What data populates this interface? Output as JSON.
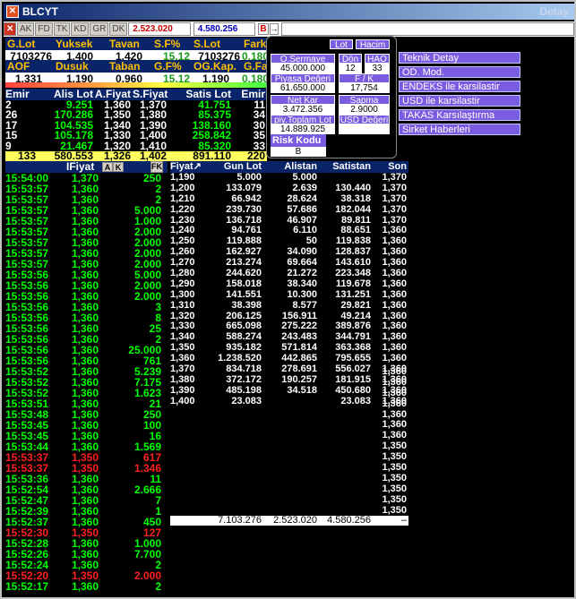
{
  "window": {
    "title": "BLCYT",
    "right_label": "Detay"
  },
  "toolbar": {
    "buttons": [
      "AK",
      "FD",
      "TK",
      "KD",
      "GR",
      "DK"
    ],
    "value1": "2.523.020",
    "value2": "4.580.256",
    "b_label": "B",
    "arrow": "→"
  },
  "quote_row1": {
    "headers": [
      "G.Lot",
      "Yuksek",
      "Tavan",
      "S.F%",
      "S.Lot",
      "Fark"
    ],
    "values": [
      "7103276",
      "1,400",
      "1,420",
      "15,12",
      "7103276",
      "0,180"
    ]
  },
  "quote_row2": {
    "headers": [
      "AOF",
      "Dusuk",
      "Taban",
      "G.F%",
      "OG.Kap.",
      "G.Fark"
    ],
    "values": [
      "1,331",
      "1,190",
      "0,960",
      "15,12",
      "1,190",
      "0,180"
    ]
  },
  "depth": {
    "headers": [
      "Emir",
      "Alis Lot",
      "A.Fiyat",
      "S.Fiyat",
      "Satis Lot",
      "Emir"
    ],
    "rows": [
      [
        "2",
        "9.251",
        "1,360",
        "1,370",
        "41.751",
        "11"
      ],
      [
        "26",
        "170.286",
        "1,350",
        "1,380",
        "85.375",
        "34"
      ],
      [
        "17",
        "104.535",
        "1,340",
        "1,390",
        "138.160",
        "30"
      ],
      [
        "15",
        "105.178",
        "1,330",
        "1,400",
        "258.842",
        "35"
      ],
      [
        "9",
        "21.467",
        "1,320",
        "1,410",
        "85.320",
        "33"
      ]
    ],
    "totals": [
      "133",
      "580.553",
      "1,326",
      "1,402",
      "891.110",
      "220"
    ]
  },
  "info": {
    "lot": "Lot",
    "hacim": "Hacim",
    "osermaye_label": "O.Sermaye",
    "osermaye": "45.000.000",
    "don_label": "Dön",
    "don": "12",
    "hao_label": "HAO",
    "hao": "33",
    "piyasa_label": "Piyasa Değeri",
    "piyasa": "61.650.000",
    "fk_label": "F / K",
    "fk": "17,754",
    "netkar_label": "Net Kar",
    "netkar": "3.472.356",
    "sapma_label": "Sapma",
    "sapma": "2.9000",
    "ptoplam_label": "piy.Toplam Lot",
    "ptoplam": "14.889.925",
    "usd_label": "USD Değeri",
    "usd": "",
    "risk_label": "Risk Kodu",
    "risk": "B"
  },
  "menu": [
    "Teknik Detay",
    "OD. Mod.",
    "ENDEKS ile karsilastir",
    "USD ile karsilastir",
    "TAKAS Karsılaştırma",
    "Sirket Haberleri"
  ],
  "trades": {
    "headers": {
      "time": "",
      "price": "IFiyat",
      "a": "A",
      "k": "K",
      "lot": "",
      "fk": "FK"
    },
    "rows": [
      [
        "15:54:00",
        "1,370",
        "250",
        ""
      ],
      [
        "15:53:57",
        "1,360",
        "2",
        ""
      ],
      [
        "15:53:57",
        "1,360",
        "2",
        ""
      ],
      [
        "15:53:57",
        "1,360",
        "5.000",
        ""
      ],
      [
        "15:53:57",
        "1,360",
        "1.000",
        ""
      ],
      [
        "15:53:57",
        "1,360",
        "2.000",
        ""
      ],
      [
        "15:53:57",
        "1,360",
        "2.000",
        ""
      ],
      [
        "15:53:57",
        "1,360",
        "2.000",
        ""
      ],
      [
        "15:53:57",
        "1,360",
        "2.000",
        ""
      ],
      [
        "15:53:56",
        "1,360",
        "5.000",
        ""
      ],
      [
        "15:53:56",
        "1,360",
        "2.000",
        ""
      ],
      [
        "15:53:56",
        "1,360",
        "2.000",
        ""
      ],
      [
        "15:53:56",
        "1,360",
        "3",
        ""
      ],
      [
        "15:53:56",
        "1,360",
        "8",
        ""
      ],
      [
        "15:53:56",
        "1,360",
        "25",
        ""
      ],
      [
        "15:53:56",
        "1,360",
        "2",
        ""
      ],
      [
        "15:53:56",
        "1,360",
        "25.000",
        ""
      ],
      [
        "15:53:56",
        "1,360",
        "761",
        ""
      ],
      [
        "15:53:52",
        "1,360",
        "5.239",
        ""
      ],
      [
        "15:53:52",
        "1,360",
        "7.175",
        ""
      ],
      [
        "15:53:52",
        "1,360",
        "1.623",
        ""
      ],
      [
        "15:53:51",
        "1,360",
        "21",
        ""
      ],
      [
        "15:53:48",
        "1,360",
        "250",
        ""
      ],
      [
        "15:53:45",
        "1,360",
        "100",
        ""
      ],
      [
        "15:53:45",
        "1,360",
        "16",
        ""
      ],
      [
        "15:53:44",
        "1,360",
        "1.569",
        ""
      ],
      [
        "15:53:37",
        "1,350",
        "617",
        "red"
      ],
      [
        "15:53:37",
        "1,350",
        "1.346",
        "red"
      ],
      [
        "15:53:36",
        "1,360",
        "11",
        ""
      ],
      [
        "15:52:54",
        "1,360",
        "2.666",
        ""
      ],
      [
        "15:52:47",
        "1,360",
        "7",
        ""
      ],
      [
        "15:52:39",
        "1,360",
        "1",
        ""
      ],
      [
        "15:52:37",
        "1,360",
        "450",
        ""
      ],
      [
        "15:52:30",
        "1,350",
        "127",
        "red"
      ],
      [
        "15:52:28",
        "1,360",
        "1.000",
        ""
      ],
      [
        "15:52:26",
        "1,360",
        "7.700",
        ""
      ],
      [
        "15:52:24",
        "1,360",
        "2",
        ""
      ],
      [
        "15:52:20",
        "1,350",
        "2.000",
        "red"
      ],
      [
        "15:52:17",
        "1,360",
        "2",
        ""
      ]
    ]
  },
  "dist": {
    "headers": [
      "Fiyat↗",
      "Gun Lot",
      "Alistan",
      "Satistan",
      "Son"
    ],
    "rows": [
      [
        "1,190",
        "5.000",
        "5.000",
        "",
        "1,370"
      ],
      [
        "1,200",
        "133.079",
        "2.639",
        "130.440",
        "1,370"
      ],
      [
        "1,210",
        "66.942",
        "28.624",
        "38.318",
        "1,370"
      ],
      [
        "1,220",
        "239.730",
        "57.686",
        "182.044",
        "1,370"
      ],
      [
        "1,230",
        "136.718",
        "46.907",
        "89.811",
        "1,370"
      ],
      [
        "1,240",
        "94.761",
        "6.110",
        "88.651",
        "1,360"
      ],
      [
        "1,250",
        "119.888",
        "50",
        "119.838",
        "1,360"
      ],
      [
        "1,260",
        "162.927",
        "34.090",
        "128.837",
        "1,360"
      ],
      [
        "1,270",
        "213.274",
        "69.664",
        "143.610",
        "1,360"
      ],
      [
        "1,280",
        "244.620",
        "21.272",
        "223.348",
        "1,360"
      ],
      [
        "1,290",
        "158.018",
        "38.340",
        "119.678",
        "1,360"
      ],
      [
        "1,300",
        "141.551",
        "10.300",
        "131.251",
        "1,360"
      ],
      [
        "1,310",
        "38.398",
        "8.577",
        "29.821",
        "1,360"
      ],
      [
        "1,320",
        "206.125",
        "156.911",
        "49.214",
        "1,360"
      ],
      [
        "1,330",
        "665.098",
        "275.222",
        "389.876",
        "1,360"
      ],
      [
        "1,340",
        "588.274",
        "243.483",
        "344.791",
        "1,360"
      ],
      [
        "1,350",
        "935.182",
        "571.814",
        "363.368",
        "1,360"
      ],
      [
        "1,360",
        "1.238.520",
        "442.865",
        "795.655",
        "1,360"
      ],
      [
        "1,370",
        "834.718",
        "278.691",
        "556.027",
        "1,360"
      ],
      [
        "1,380",
        "372.172",
        "190.257",
        "181.915",
        "1,360"
      ],
      [
        "1,390",
        "485.198",
        "34.518",
        "450.680",
        "1,360"
      ],
      [
        "1,400",
        "23.083",
        "",
        "23.083",
        "1,360"
      ]
    ],
    "totals": [
      "7.103.276",
      "2.523.020",
      "4.580.256",
      "–"
    ],
    "son_tail": [
      "1,360",
      "1,360",
      "1,360",
      "1,360",
      "1,360",
      "1,360",
      "1,360",
      "1,350",
      "1,350",
      "1,350",
      "1,350",
      "1,350",
      "1,350",
      "1,350"
    ]
  }
}
